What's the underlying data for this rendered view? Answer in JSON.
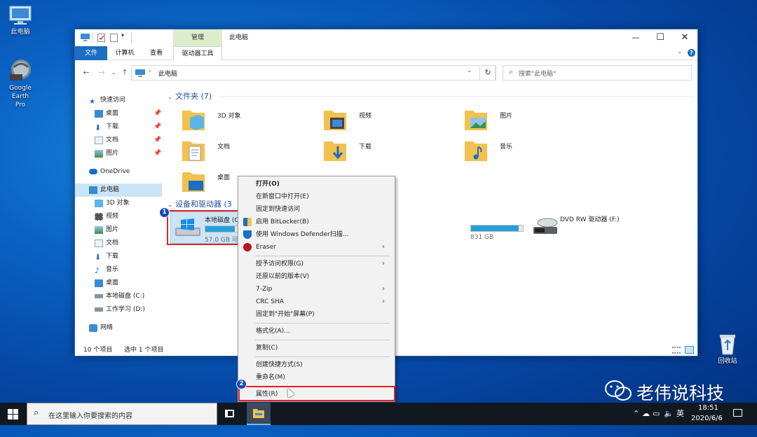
{
  "desktop": {
    "this_pc": "此电脑",
    "google_earth": "Google Earth Pro",
    "recycle_bin": "回收站"
  },
  "window": {
    "manage_tab": "管理",
    "title": "此电脑",
    "minimize": "—",
    "maximize": "☐",
    "close": "✕",
    "tabs": [
      "文件",
      "计算机",
      "查看",
      "驱动器工具"
    ],
    "address": "此电脑",
    "search_placeholder": "搜索\"此电脑\"",
    "status_count": "10 个项目",
    "status_selected": "选中 1 个项目"
  },
  "nav": {
    "quick_access": "快速访问",
    "desktop": "桌面",
    "downloads": "下载",
    "documents": "文档",
    "pictures": "图片",
    "onedrive": "OneDrive",
    "this_pc": "此电脑",
    "objects3d": "3D 对象",
    "videos": "视频",
    "pictures2": "图片",
    "documents2": "文档",
    "downloads2": "下载",
    "music": "音乐",
    "desktop2": "桌面",
    "local_c": "本地磁盘 (C:)",
    "work_d": "工作学习 (D:)",
    "network": "网络"
  },
  "content": {
    "folders_header": "文件夹 (7)",
    "folders": [
      "3D 对象",
      "视频",
      "图片",
      "文档",
      "下载",
      "音乐",
      "桌面"
    ],
    "drives_header": "设备和驱动器 (3",
    "drive_c_name": "本地磁盘 (C",
    "drive_c_free": "57.0 GB 可",
    "drive_d_free": "831 GB",
    "drive_c_used": 0.78,
    "drive_d_used": 0.92,
    "dvd": "DVD RW 驱动器 (F:)"
  },
  "context_menu": {
    "items": [
      "打开(O)",
      "在新窗口中打开(E)",
      "固定到快速访问",
      "启用 BitLocker(B)",
      "使用 Windows Defender扫描...",
      "Eraser",
      "授予访问权限(G)",
      "还原以前的版本(V)",
      "7-Zip",
      "CRC SHA",
      "固定到\"开始\"屏幕(P)",
      "格式化(A)...",
      "复制(C)",
      "创建快捷方式(S)",
      "重命名(M)",
      "属性(R)"
    ]
  },
  "annotations": {
    "step1": "1",
    "step2": "2"
  },
  "watermark": "老伟说科技",
  "taskbar": {
    "search_placeholder": "在这里输入你要搜索的内容",
    "ime": "英",
    "time": "18:51",
    "date": "2020/6/6"
  }
}
